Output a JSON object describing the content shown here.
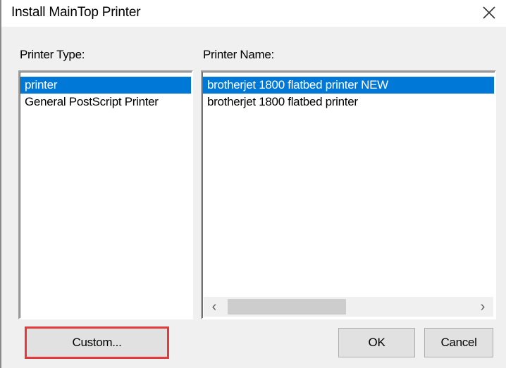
{
  "window": {
    "title": "Install MainTop Printer"
  },
  "labels": {
    "printer_type": "Printer Type:",
    "printer_name": "Printer Name:"
  },
  "printer_types": [
    {
      "label": "printer",
      "selected": true
    },
    {
      "label": "General PostScript Printer",
      "selected": false
    }
  ],
  "printer_names": [
    {
      "label": "brotherjet 1800 flatbed printer NEW",
      "selected": true
    },
    {
      "label": "brotherjet 1800 flatbed printer",
      "selected": false
    }
  ],
  "scrollbar": {
    "left_arrow": "‹",
    "right_arrow": "›"
  },
  "buttons": {
    "custom": "Custom...",
    "ok": "OK",
    "cancel": "Cancel"
  },
  "colors": {
    "selection": "#0078d7",
    "highlight_border": "#e23b3b"
  },
  "icons": {
    "close": "close-icon",
    "scroll_left": "chevron-left-icon",
    "scroll_right": "chevron-right-icon"
  }
}
